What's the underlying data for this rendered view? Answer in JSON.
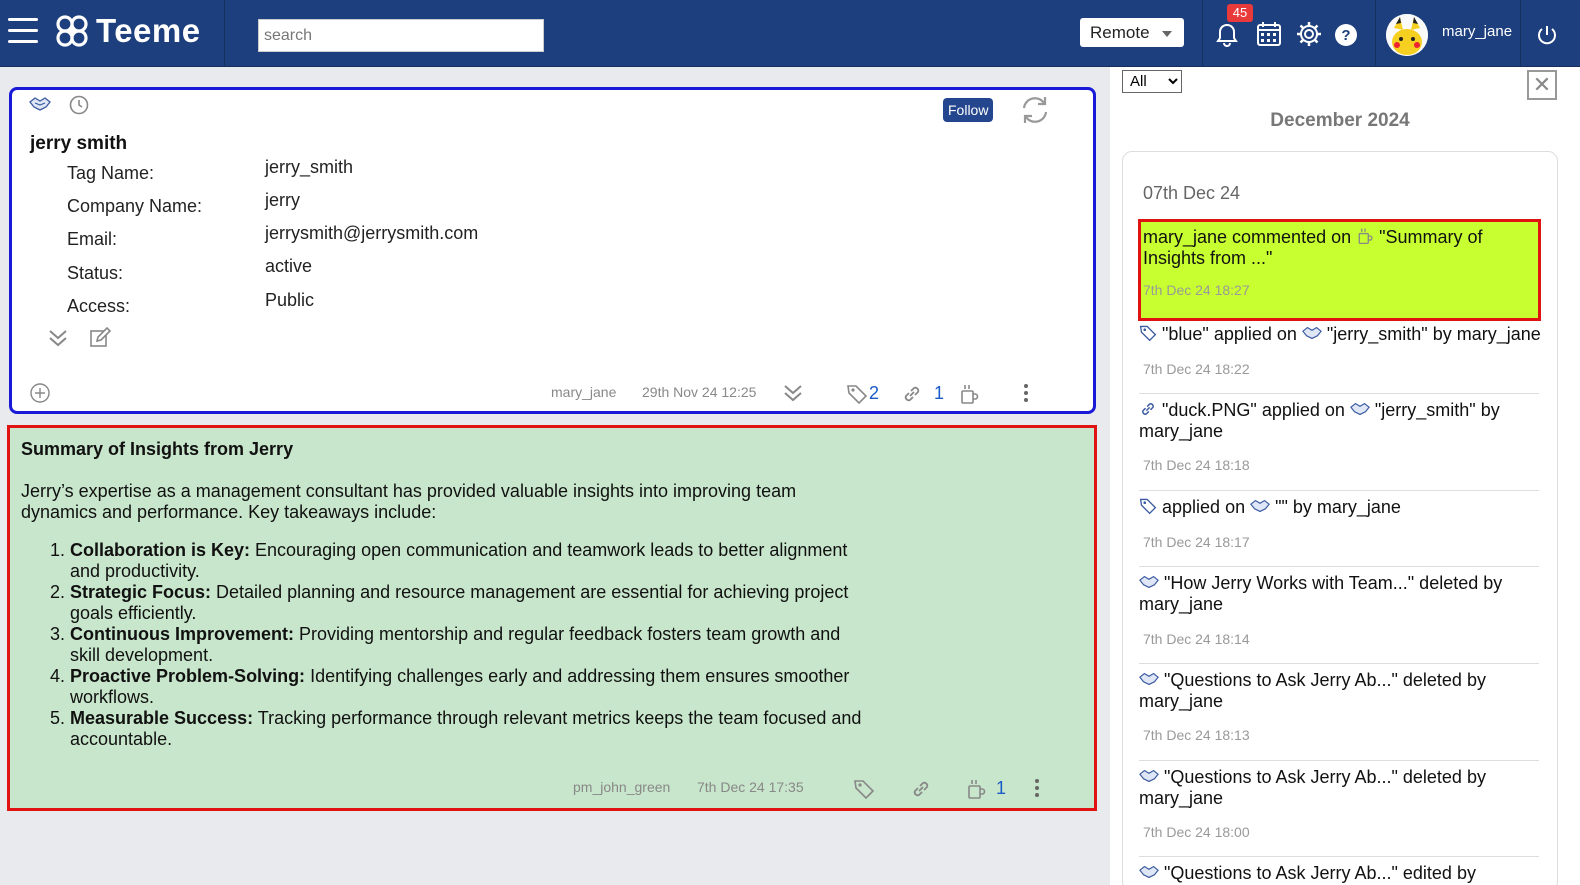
{
  "header": {
    "logo_text": "Teeme",
    "search_placeholder": "search",
    "mode_label": "Remote",
    "notification_count": "45",
    "username": "mary_jane",
    "colors": {
      "bar": "#1d3f7e",
      "badge": "#e83a3a"
    }
  },
  "profile_card": {
    "follow_label": "Follow",
    "name": "jerry smith",
    "fields": [
      {
        "label": "Tag Name:",
        "value": "jerry_smith"
      },
      {
        "label": "Company Name:",
        "value": "jerry"
      },
      {
        "label": "Email:",
        "value": "jerrysmith@jerrysmith.com"
      },
      {
        "label": "Status:",
        "value": "active"
      },
      {
        "label": "Access:",
        "value": "Public"
      }
    ],
    "author": "mary_jane",
    "timestamp": "29th Nov 24 12:25",
    "tag_count": "2",
    "link_count": "1"
  },
  "note_card": {
    "title": "Summary of Insights from Jerry",
    "intro": "Jerry’s expertise as a management consultant has provided valuable insights into improving team dynamics and performance. Key takeaways include:",
    "items": [
      {
        "heading": "Collaboration is Key:",
        "text": " Encouraging open communication and teamwork leads to better alignment and productivity."
      },
      {
        "heading": "Strategic Focus:",
        "text": " Detailed planning and resource management are essential for achieving project goals efficiently."
      },
      {
        "heading": "Continuous Improvement:",
        "text": " Providing mentorship and regular feedback fosters team growth and skill development."
      },
      {
        "heading": "Proactive Problem-Solving:",
        "text": " Identifying challenges early and addressing them ensures smoother workflows."
      },
      {
        "heading": "Measurable Success:",
        "text": " Tracking performance through relevant metrics keeps the team focused and accountable."
      }
    ],
    "author": "pm_john_green",
    "timestamp": "7th Dec 24 17:35",
    "comment_count": "1"
  },
  "activity": {
    "filter_value": "All",
    "close_label": "✕",
    "month": "December 2024",
    "day": "07th Dec 24",
    "items": [
      {
        "text_a": "mary_jane commented on ",
        "text_b": " \"Summary of Insights from ...\"",
        "time": "7th Dec 24 18:27"
      },
      {
        "text_a": "\"blue\" applied on ",
        "text_b": " \"jerry_smith\" by mary_jane",
        "time": "7th Dec 24 18:22"
      },
      {
        "text_a": "\"duck.PNG\" applied on ",
        "text_b": " \"jerry_smith\" by mary_jane",
        "time": "7th Dec 24 18:18"
      },
      {
        "text_a": "applied on ",
        "text_b": " \"\" by mary_jane",
        "time": "7th Dec 24 18:17"
      },
      {
        "text_a": "\"How Jerry Works with Team...\" deleted by mary_jane",
        "time": "7th Dec 24 18:14"
      },
      {
        "text_a": "\"Questions to Ask Jerry Ab...\" deleted by mary_jane",
        "time": "7th Dec 24 18:13"
      },
      {
        "text_a": "\"Questions to Ask Jerry Ab...\" deleted by mary_jane",
        "time": "7th Dec 24 18:00"
      },
      {
        "text_a": "\"Questions to Ask Jerry Ab...\" edited by"
      }
    ],
    "highlight_color": "#c8ff30"
  }
}
